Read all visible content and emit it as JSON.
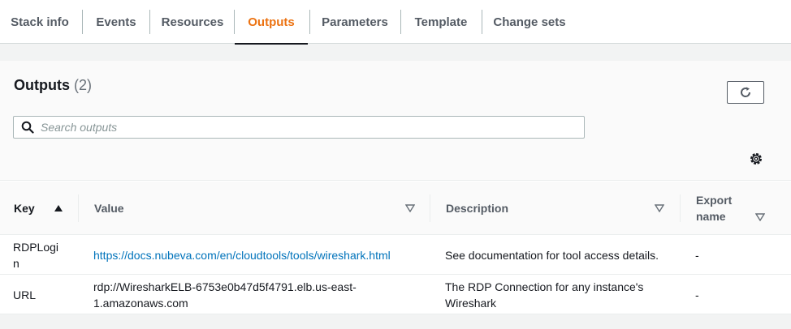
{
  "tabs": [
    {
      "label": "Stack info"
    },
    {
      "label": "Events"
    },
    {
      "label": "Resources"
    },
    {
      "label": "Outputs"
    },
    {
      "label": "Parameters"
    },
    {
      "label": "Template"
    },
    {
      "label": "Change sets"
    }
  ],
  "active_tab": "Outputs",
  "panel": {
    "title": "Outputs",
    "count": "(2)",
    "refresh_icon": "refresh-icon",
    "settings_icon": "gear-icon"
  },
  "search": {
    "placeholder": "Search outputs",
    "value": ""
  },
  "table": {
    "columns": [
      {
        "label": "Key",
        "sort": "ascending"
      },
      {
        "label": "Value",
        "sort": "none"
      },
      {
        "label": "Description",
        "sort": "none"
      },
      {
        "label": "Export name",
        "sort": "none"
      }
    ],
    "rows": [
      {
        "key_line1": "RDPLogi",
        "key_line2": "n",
        "value": "https://docs.nubeva.com/en/cloudtools/tools/wireshark.html",
        "value_is_link": true,
        "description": "See documentation for tool access details.",
        "export": "-"
      },
      {
        "key": "URL",
        "value_line1": "rdp://WiresharkELB-6753e0b47d5f4791.elb.us-east-",
        "value_line2": "1.amazonaws.com",
        "value_is_link": false,
        "description_line1": "The RDP Connection for any instance's",
        "description_line2": "Wireshark",
        "export": "-"
      }
    ]
  },
  "colors": {
    "accent": "#ec7211",
    "link": "#0073bb",
    "text": "#16191f",
    "muted": "#545b64"
  }
}
